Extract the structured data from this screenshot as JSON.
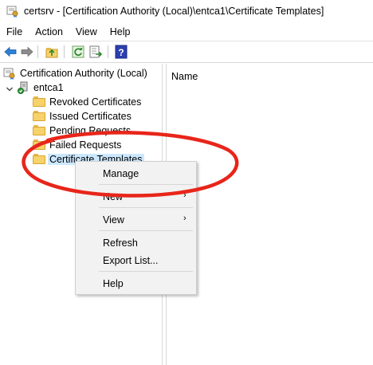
{
  "window": {
    "title": "certsrv - [Certification Authority (Local)\\entca1\\Certificate Templates]",
    "app_icon": "certsrv-app-icon"
  },
  "menubar": {
    "items": [
      {
        "label": "File"
      },
      {
        "label": "Action"
      },
      {
        "label": "View"
      },
      {
        "label": "Help"
      }
    ]
  },
  "toolbar": {
    "buttons": [
      {
        "icon": "back-arrow-icon"
      },
      {
        "icon": "forward-arrow-icon"
      },
      {
        "icon": "up-folder-icon"
      },
      {
        "icon": "refresh-icon"
      },
      {
        "icon": "export-list-icon"
      },
      {
        "icon": "help-icon"
      }
    ]
  },
  "tree": {
    "root": {
      "label": "Certification Authority (Local)"
    },
    "ca": {
      "label": "entca1",
      "expanded": true
    },
    "children": [
      {
        "label": "Revoked Certificates"
      },
      {
        "label": "Issued Certificates"
      },
      {
        "label": "Pending Requests"
      },
      {
        "label": "Failed Requests"
      },
      {
        "label": "Certificate Templates",
        "selected": true
      }
    ]
  },
  "details": {
    "columns": [
      {
        "label": "Name"
      }
    ]
  },
  "context_menu": {
    "items": [
      {
        "label": "Manage",
        "submenu": false
      },
      {
        "label": "New",
        "submenu": true
      },
      {
        "label": "View",
        "submenu": true
      },
      {
        "label": "Refresh",
        "submenu": false
      },
      {
        "label": "Export List...",
        "submenu": false
      },
      {
        "label": "Help",
        "submenu": false
      }
    ],
    "arrow_glyph": "›"
  },
  "colors": {
    "selection": "#cce8ff",
    "annotation": "#e8251a",
    "menu_bg": "#f2f2f2"
  }
}
